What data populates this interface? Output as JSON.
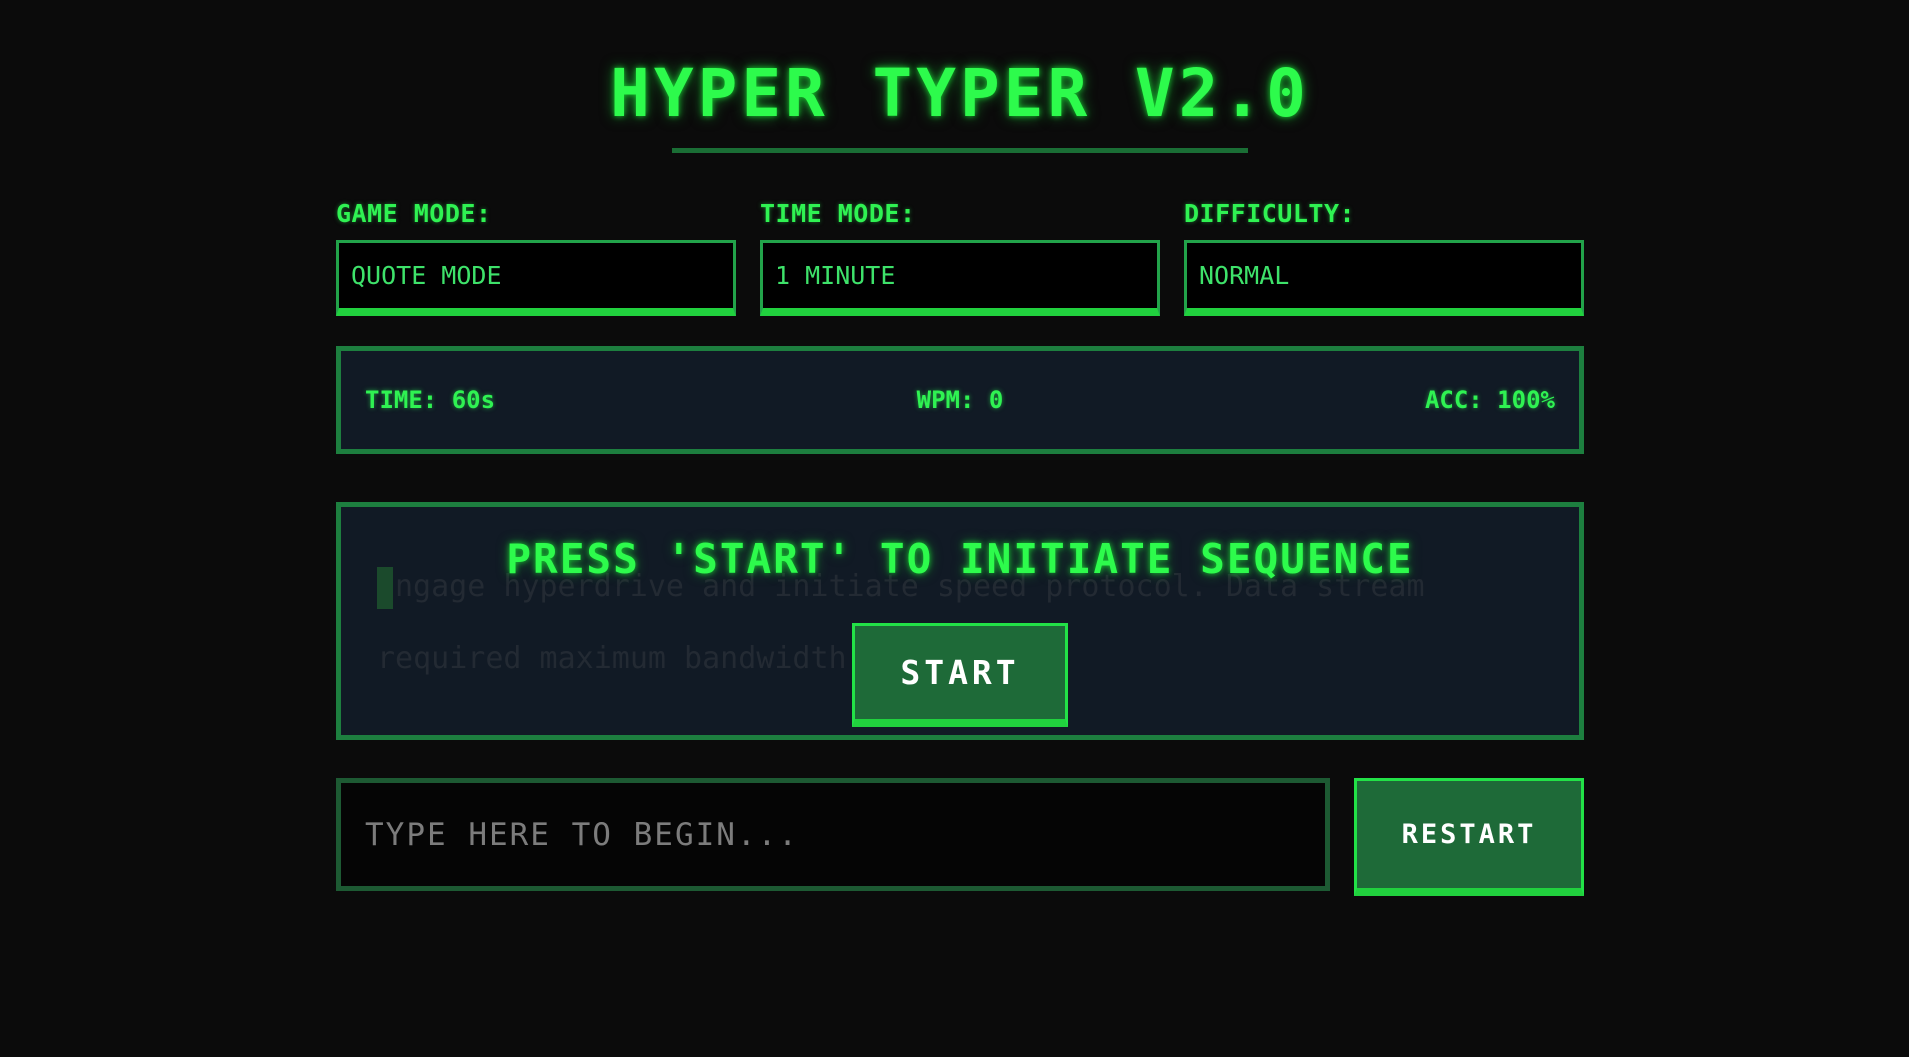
{
  "app": {
    "title": "HYPER TYPER V2.0"
  },
  "settings": {
    "game_mode": {
      "label": "GAME MODE:",
      "value": "QUOTE MODE"
    },
    "time_mode": {
      "label": "TIME MODE:",
      "value": "1 MINUTE"
    },
    "difficulty": {
      "label": "DIFFICULTY:",
      "value": "NORMAL"
    }
  },
  "stats": {
    "time": "TIME: 60s",
    "wpm": "WPM: 0",
    "accuracy": "ACC: 100%"
  },
  "stage": {
    "passage_line_1": "ngage hyperdrive and initiate speed protocol. Data stream",
    "passage_line_2": "required maximum bandwidth.",
    "prompt": "PRESS 'START' TO INITIATE SEQUENCE",
    "start_label": "START"
  },
  "input": {
    "placeholder": "TYPE HERE TO BEGIN...",
    "value": ""
  },
  "controls": {
    "restart_label": "RESTART"
  },
  "colors": {
    "background": "#0b0b0b",
    "accent_green": "#2dfb4c",
    "border_green": "#1d7f3f",
    "button_green": "#1e6a38",
    "panel_bg": "#111a25"
  }
}
